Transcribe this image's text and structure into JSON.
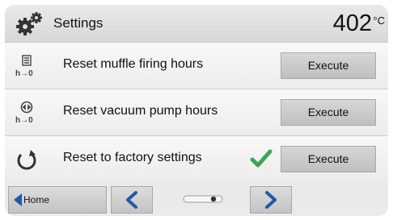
{
  "header": {
    "title": "Settings",
    "temperature": "402",
    "unit": "°C"
  },
  "rows": [
    {
      "icon": "muffle-firing-hours-reset-icon",
      "label": "Reset muffle firing hours",
      "button": "Execute"
    },
    {
      "icon": "vacuum-pump-hours-reset-icon",
      "label": "Reset vacuum pump hours",
      "button": "Execute"
    },
    {
      "icon": "factory-reset-icon",
      "label": "Reset to factory settings",
      "button": "Execute",
      "status_icon": "checkmark-icon"
    }
  ],
  "footer": {
    "home_label": "Home"
  },
  "colors": {
    "check": "#3aa655",
    "nav_arrow": "#1f5aa6"
  }
}
